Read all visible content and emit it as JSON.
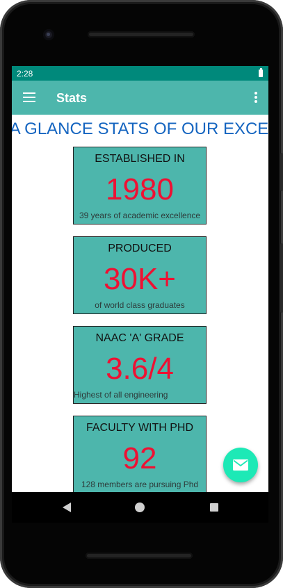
{
  "status": {
    "time": "2:28"
  },
  "app_bar": {
    "title": "Stats"
  },
  "marquee": {
    "text": "AT A GLANCE STATS OF OUR EXCE"
  },
  "cards": [
    {
      "title": "ESTABLISHED IN",
      "value": "1980",
      "subtitle": "39 years of academic excellence"
    },
    {
      "title": "PRODUCED",
      "value": "30K+",
      "subtitle": "of world class graduates"
    },
    {
      "title": "NAAC 'A' GRADE",
      "value": "3.6/4",
      "subtitle": "Highest of all engineering"
    },
    {
      "title": "FACULTY WITH PHD",
      "value": "92",
      "subtitle": "128 members are pursuing Phd"
    }
  ],
  "colors": {
    "status_bar": "#00897b",
    "app_bar": "#4db6ac",
    "card_bg": "#4db6ac",
    "value_text": "#ee1133",
    "marquee_text": "#1565c0",
    "fab": "#1de9b6"
  },
  "icons": {
    "menu": "menu-icon",
    "overflow": "more-vert-icon",
    "fab": "mail-icon",
    "nav_back": "back-icon",
    "nav_home": "home-icon",
    "nav_recent": "recent-apps-icon"
  }
}
